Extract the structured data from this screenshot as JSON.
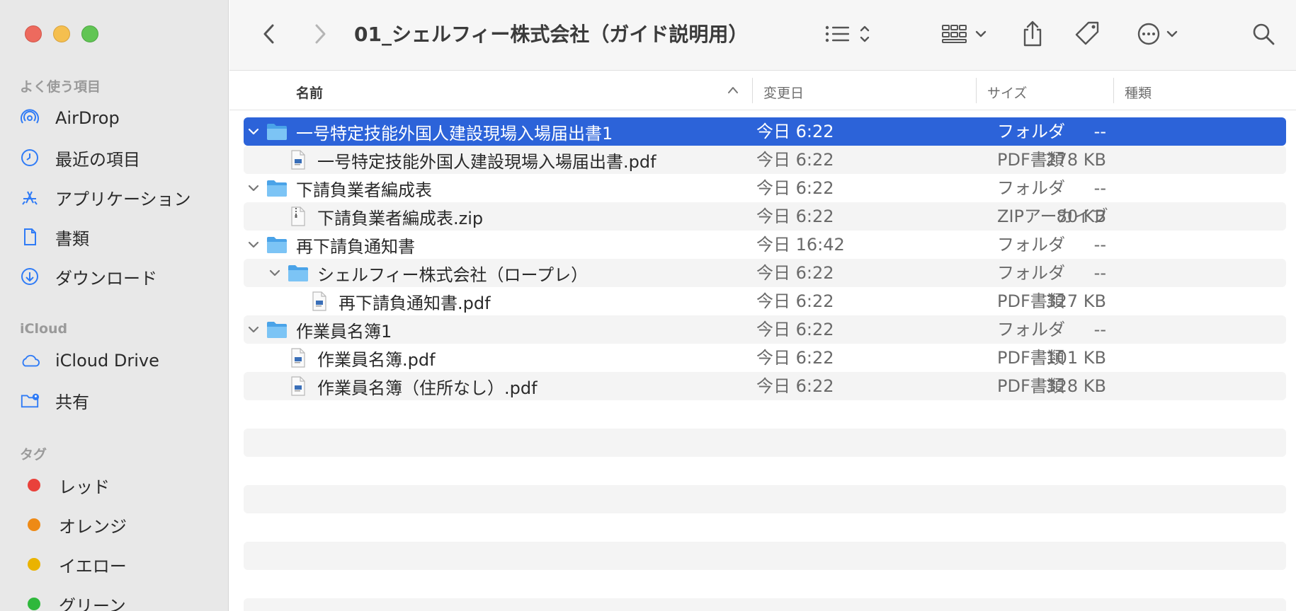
{
  "window": {
    "title": "01_シェルフィー株式会社（ガイド説明用）"
  },
  "sidebar": {
    "favorites_header": "よく使う項目",
    "favorites": [
      {
        "label": "AirDrop",
        "icon": "airdrop-icon"
      },
      {
        "label": "最近の項目",
        "icon": "clock-icon"
      },
      {
        "label": "アプリケーション",
        "icon": "applications-icon"
      },
      {
        "label": "書類",
        "icon": "document-icon"
      },
      {
        "label": "ダウンロード",
        "icon": "download-icon"
      }
    ],
    "icloud_header": "iCloud",
    "icloud": [
      {
        "label": "iCloud Drive",
        "icon": "cloud-icon"
      },
      {
        "label": "共有",
        "icon": "shared-folder-icon"
      }
    ],
    "tags_header": "タグ",
    "tags": [
      {
        "label": "レッド",
        "color": "#e9413b"
      },
      {
        "label": "オレンジ",
        "color": "#ee8a16"
      },
      {
        "label": "イエロー",
        "color": "#eab300"
      },
      {
        "label": "グリーン",
        "color": "#2fb83c"
      }
    ]
  },
  "columns": {
    "name": "名前",
    "date": "変更日",
    "size": "サイズ",
    "kind": "種類"
  },
  "files": [
    {
      "name": "一号特定技能外国人建設現場入場届出書1",
      "date": "今日 6:22",
      "size": "--",
      "kind": "フォルダ",
      "type": "folder",
      "level": 0,
      "selected": true
    },
    {
      "name": "一号特定技能外国人建設現場入場届出書.pdf",
      "date": "今日 6:22",
      "size": "278 KB",
      "kind": "PDF書類",
      "type": "pdf",
      "level": 1
    },
    {
      "name": "下請負業者編成表",
      "date": "今日 6:22",
      "size": "--",
      "kind": "フォルダ",
      "type": "folder",
      "level": 0
    },
    {
      "name": "下請負業者編成表.zip",
      "date": "今日 6:22",
      "size": "80 KB",
      "kind": "ZIPアーカイブ",
      "type": "zip",
      "level": 1
    },
    {
      "name": "再下請負通知書",
      "date": "今日 16:42",
      "size": "--",
      "kind": "フォルダ",
      "type": "folder",
      "level": 0
    },
    {
      "name": "シェルフィー株式会社（ロープレ）",
      "date": "今日 6:22",
      "size": "--",
      "kind": "フォルダ",
      "type": "folder",
      "level": 1
    },
    {
      "name": "再下請負通知書.pdf",
      "date": "今日 6:22",
      "size": "327 KB",
      "kind": "PDF書類",
      "type": "pdf",
      "level": 2
    },
    {
      "name": "作業員名簿1",
      "date": "今日 6:22",
      "size": "--",
      "kind": "フォルダ",
      "type": "folder",
      "level": 0
    },
    {
      "name": "作業員名簿.pdf",
      "date": "今日 6:22",
      "size": "101 KB",
      "kind": "PDF書類",
      "type": "pdf",
      "level": 1
    },
    {
      "name": "作業員名簿（住所なし）.pdf",
      "date": "今日 6:22",
      "size": "328 KB",
      "kind": "PDF書類",
      "type": "pdf",
      "level": 1
    }
  ]
}
